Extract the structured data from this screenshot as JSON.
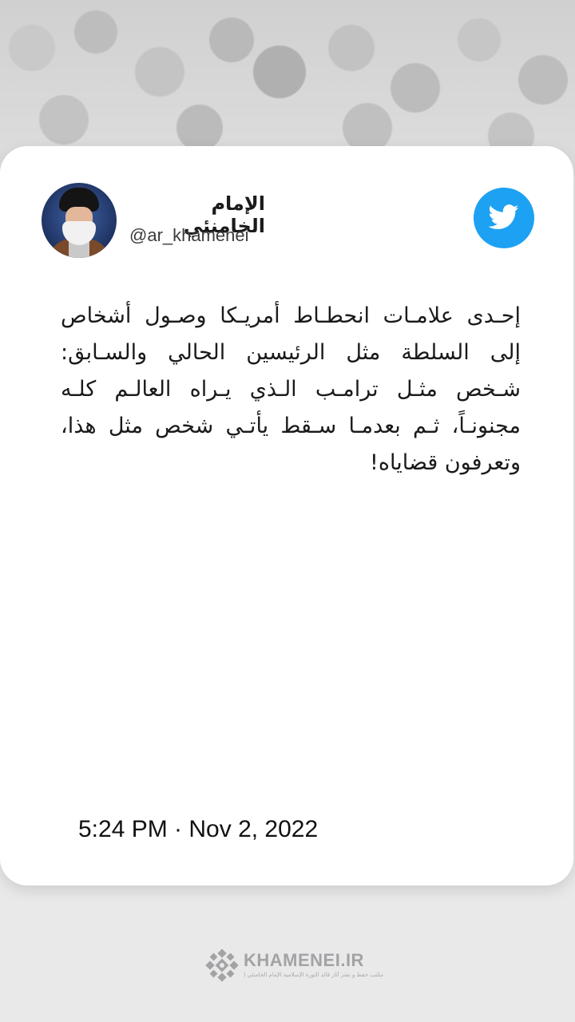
{
  "profile": {
    "display_name": "الإمام الخامنئي",
    "handle": "@ar_khamenei"
  },
  "tweet": {
    "text": "إحـدى علامـات انحطـاط أمريـكا وصـول أشخاص إلى السلطة مثل الرئيسين الحالي والسـابق: شـخص مثـل ترامـب الـذي يـراه العالـم كلـه مجنونـاً، ثـم بعدمـا سـقط يأتـي شخص مثل هذا، وتعرفون قضاياه!",
    "timestamp": "5:24 PM · Nov 2, 2022"
  },
  "footer": {
    "brand": "KHAMENEI.IR",
    "subtitle": "مكتب حفظ و نشر آثار قائد الثورة الإسلامية الإمام الخامنئي (دام ظله)"
  },
  "icons": {
    "platform": "twitter-bird-icon",
    "brand_mark": "khamenei-logo-mark"
  },
  "colors": {
    "twitter_blue": "#1da1f2",
    "card": "#ffffff",
    "background": "#e9e9ea"
  }
}
